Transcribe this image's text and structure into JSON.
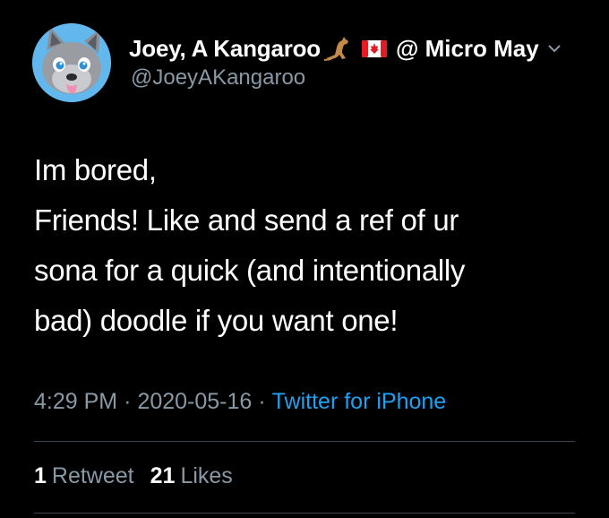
{
  "tweet": {
    "author": {
      "display_name": "Joey, A Kangaroo",
      "name_suffix": "@ Micro May",
      "handle": "@JoeyAKangaroo",
      "avatar_icon": "wolf-character-avatar",
      "avatar_bg": "#62b7ec"
    },
    "text_lines": [
      "Im bored,",
      "Friends! Like and send a ref of ur",
      "sona for a quick (and intentionally",
      "bad) doodle if you want one!"
    ],
    "time": "4:29 PM",
    "date": "2020-05-16",
    "separator": "·",
    "source": "Twitter for iPhone",
    "stats": {
      "retweets_count": "1",
      "retweets_label": "Retweet",
      "likes_count": "21",
      "likes_label": "Likes"
    }
  },
  "colors": {
    "background": "#000000",
    "text": "#ffffff",
    "secondary": "#8899a6",
    "link": "#1da1f2",
    "divider": "#38444d"
  }
}
